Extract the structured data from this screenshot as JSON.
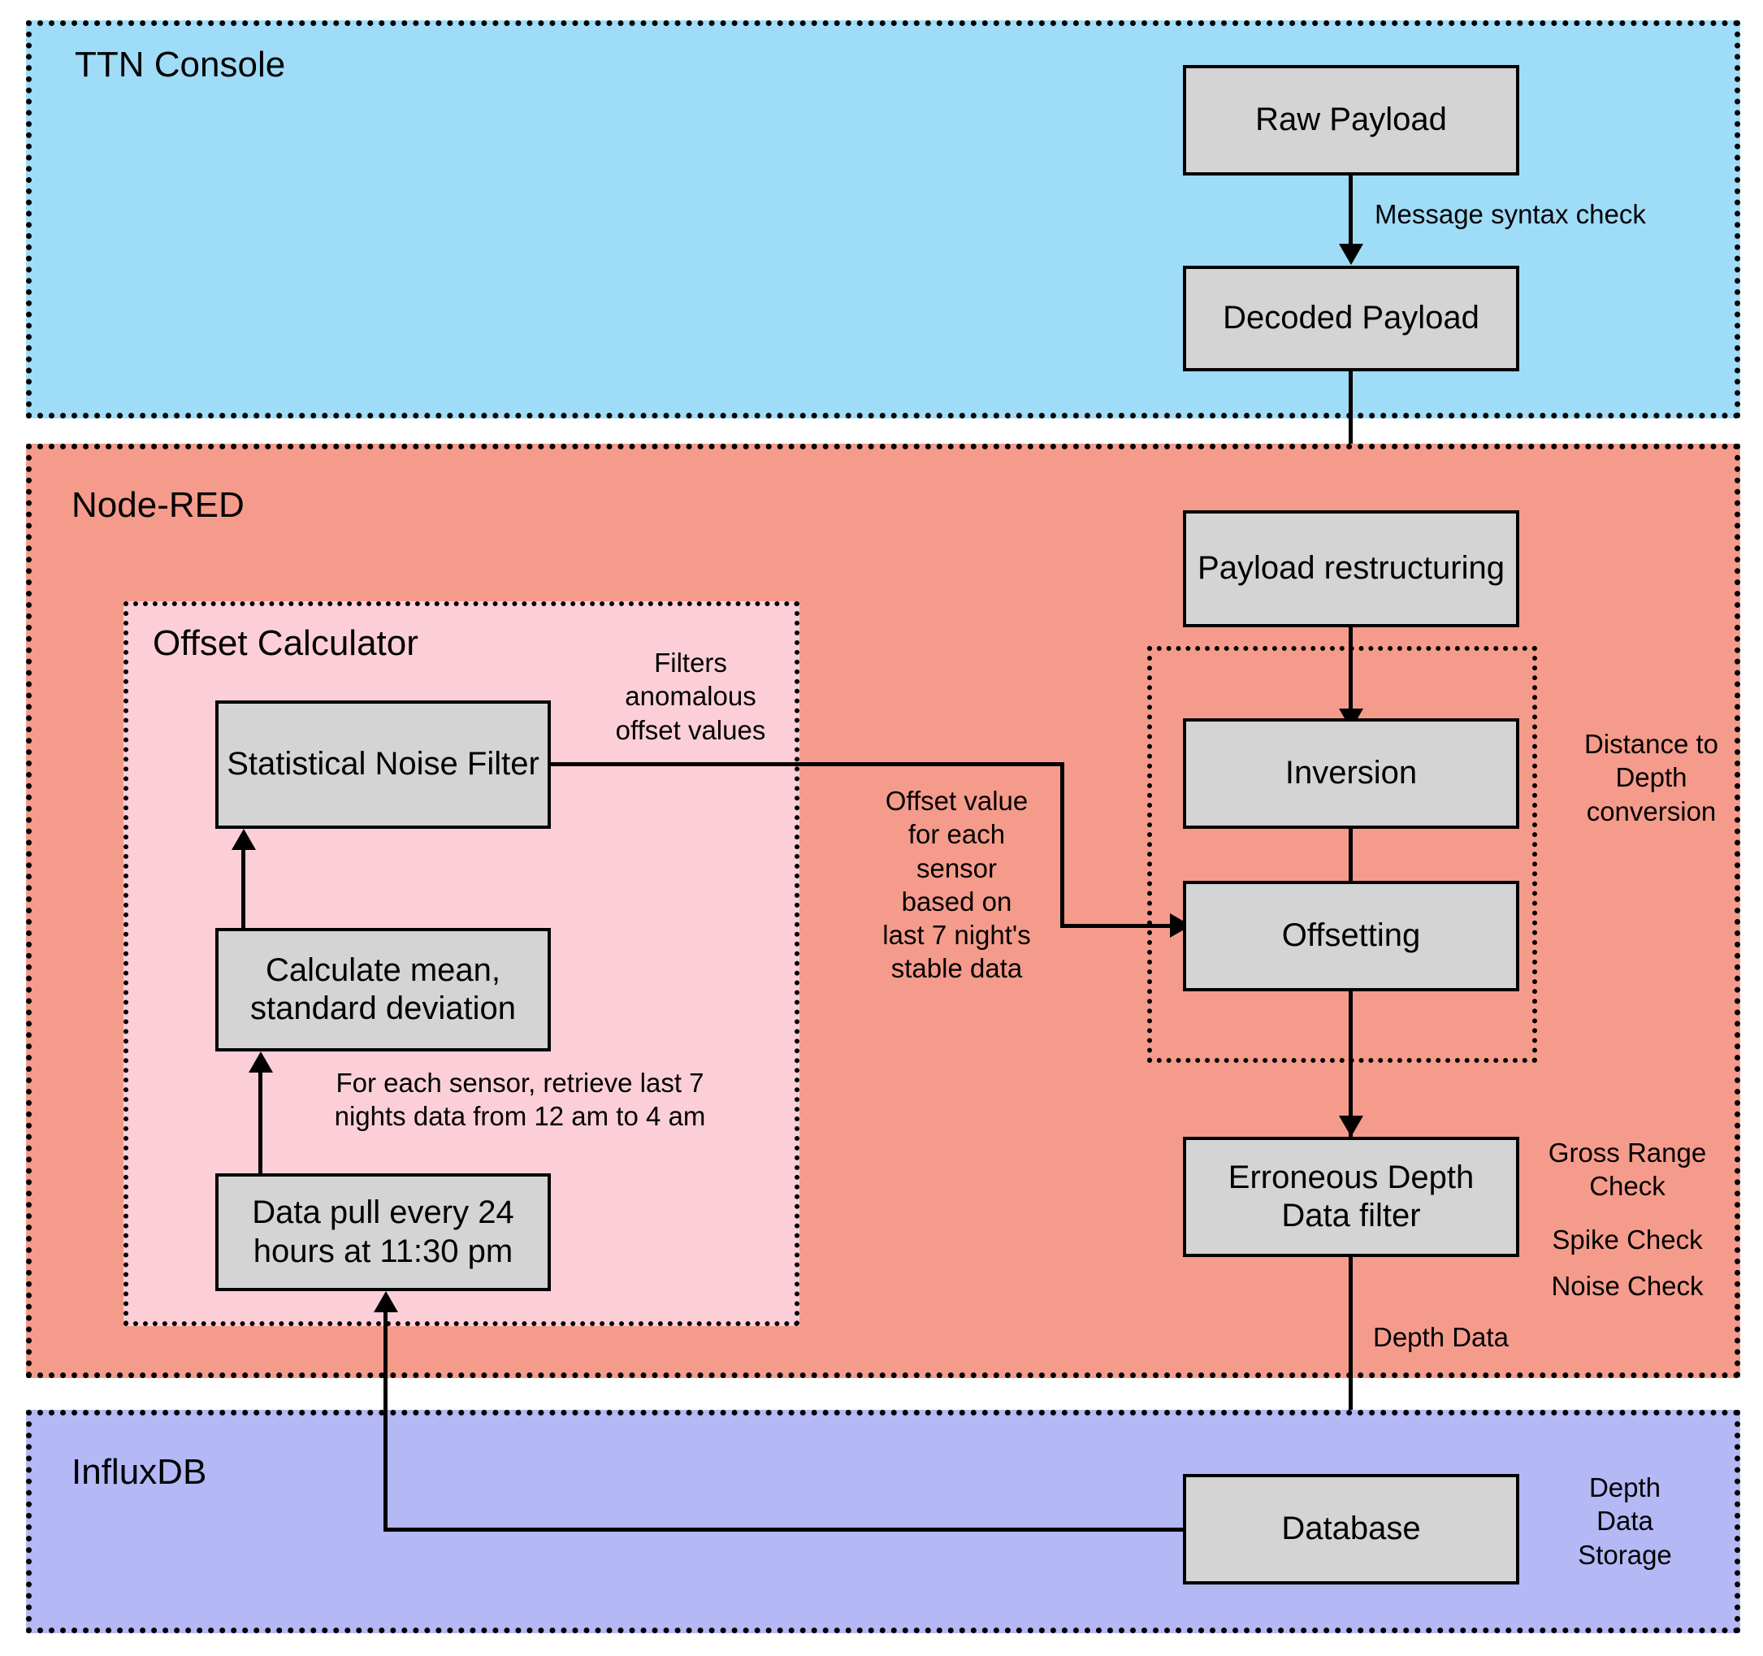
{
  "diagram": {
    "title": "IoT depth-sensor data processing pipeline",
    "colors": {
      "ttn_lane": "#9fdcf8",
      "nodered_lane": "#f59b8b",
      "influxdb_lane": "#b4b8f5",
      "offset_calculator_group": "#fccfd8",
      "node_fill": "#d4d4d4",
      "stroke": "#000000"
    }
  },
  "lanes": {
    "ttn": {
      "label": "TTN Console"
    },
    "nodered": {
      "label": "Node-RED"
    },
    "influxdb": {
      "label": "InfluxDB"
    }
  },
  "groups": {
    "offset_calculator": {
      "label": "Offset Calculator"
    },
    "distance_to_depth": {
      "label": "Distance to\nDepth\nconversion"
    }
  },
  "nodes": {
    "raw_payload": {
      "label": "Raw Payload"
    },
    "decoded_payload": {
      "label": "Decoded Payload"
    },
    "payload_restructuring": {
      "label": "Payload\nrestructuring"
    },
    "inversion": {
      "label": "Inversion"
    },
    "offsetting": {
      "label": "Offsetting"
    },
    "erroneous_depth_data_filter": {
      "label": "Erroneous Depth\nData filter"
    },
    "database": {
      "label": "Database"
    },
    "statistical_noise_filter": {
      "label": "Statistical Noise\nFilter"
    },
    "calculate_mean_std": {
      "label": "Calculate mean,\nstandard deviation"
    },
    "data_pull": {
      "label": "Data pull every 24\nhours at 11:30 pm"
    }
  },
  "annotations": {
    "message_syntax_check": "Message syntax check",
    "filters_anomalous": "Filters\nanomalous\noffset values",
    "offset_value_desc": "Offset value\nfor each\nsensor\nbased on\nlast 7 night's\nstable data",
    "retrieve_last_7_nights": "For each sensor, retrieve last 7\nnights data from 12 am to 4 am",
    "quality_checks": "Gross Range\nCheck",
    "spike_check": "Spike Check",
    "noise_check": "Noise Check",
    "depth_data": "Depth Data",
    "depth_data_storage": "Depth\nData\nStorage"
  }
}
